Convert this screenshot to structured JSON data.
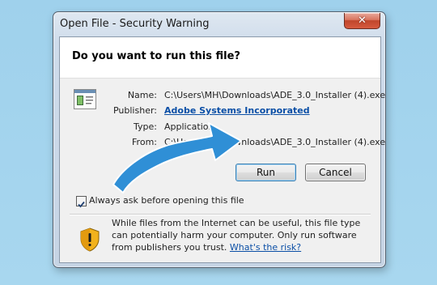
{
  "window": {
    "title": "Open File - Security Warning",
    "close_glyph": "✕"
  },
  "dialog": {
    "question": "Do you want to run this file?",
    "fields": [
      {
        "label": "Name:",
        "value": "C:\\Users\\MH\\Downloads\\ADE_3.0_Installer (4).exe"
      },
      {
        "label": "Publisher:",
        "value": "Adobe Systems Incorporated"
      },
      {
        "label": "Type:",
        "value": "Application"
      },
      {
        "label": "From:",
        "value": "C:\\Users\\MH\\Downloads\\ADE_3.0_Installer (4).exe"
      }
    ],
    "run_label": "Run",
    "cancel_label": "Cancel",
    "checkbox_label": "Always ask before opening this file",
    "checkbox_checked": true,
    "warning_text": "While files from the Internet can be useful, this file type can potentially harm your computer. Only run software from publishers you trust.",
    "risk_link": "What's the risk?"
  },
  "icons": {
    "file": "file-icon",
    "shield": "shield-icon",
    "arrow": "arrow-annotation"
  },
  "colors": {
    "desktop": "#a3d3ec",
    "link": "#0b4fa6",
    "arrow": "#2f8fd6"
  }
}
